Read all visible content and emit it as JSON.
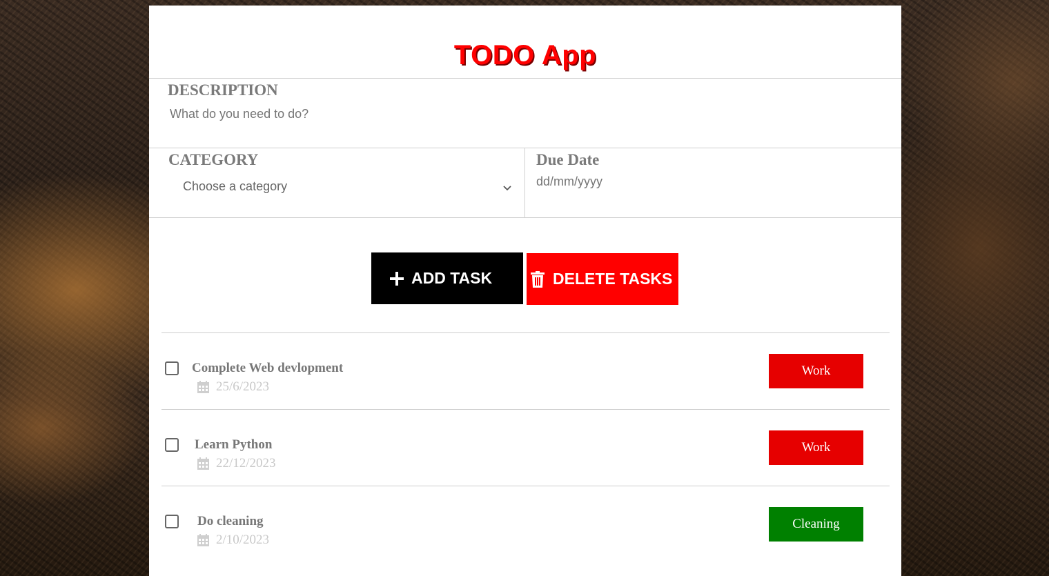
{
  "app": {
    "title": "TODO App"
  },
  "form": {
    "description": {
      "label": "DESCRIPTION",
      "placeholder": "What do you need to do?"
    },
    "category": {
      "label": "CATEGORY",
      "selected": "Choose a category"
    },
    "due_date": {
      "label": "Due Date",
      "placeholder": "dd/mm/yyyy"
    }
  },
  "actions": {
    "add_label": "ADD TASK",
    "delete_label": "DELETE TASKS",
    "add_color": "#000000",
    "delete_color": "#ff0000"
  },
  "tasks": [
    {
      "title": "Complete Web devlopment",
      "date": "25/6/2023",
      "category": "Work",
      "category_color": "#e60000",
      "checked": false
    },
    {
      "title": "Learn Python",
      "date": "22/12/2023",
      "category": "Work",
      "category_color": "#e60000",
      "checked": false
    },
    {
      "title": "Do cleaning",
      "date": "2/10/2023",
      "category": "Cleaning",
      "category_color": "#008000",
      "checked": false
    }
  ],
  "icons": {
    "add": "plus-icon",
    "delete": "trash-icon",
    "date": "calendar-icon",
    "select": "chevron-down-icon"
  }
}
